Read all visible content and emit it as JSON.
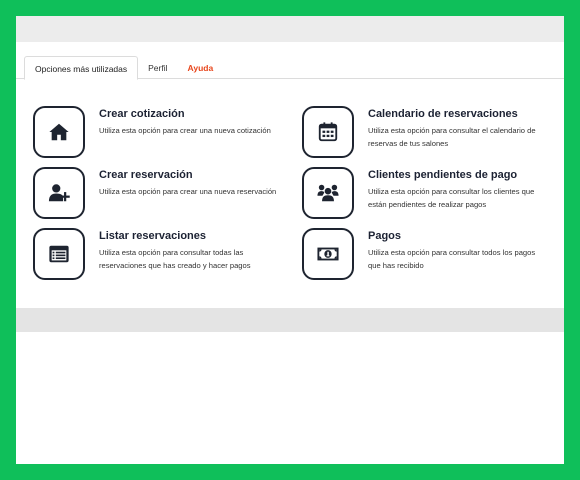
{
  "tabs": [
    {
      "label": "Opciones más utilizadas"
    },
    {
      "label": "Perfil"
    },
    {
      "label": "Ayuda"
    }
  ],
  "colors": {
    "background": "#0fbf5a",
    "accent": "#e8461c",
    "icon": "#1e2430"
  },
  "options": [
    {
      "title": "Crear cotización",
      "description": "Utiliza esta opción para crear una nueva cotización",
      "icon": "home-icon"
    },
    {
      "title": "Calendario de reservaciones",
      "description": "Utiliza esta opción para consultar el calendario de reservas de tus salones",
      "icon": "calendar-icon"
    },
    {
      "title": "Crear reservación",
      "description": "Utiliza esta opción para crear una nueva reservación",
      "icon": "add-user-icon"
    },
    {
      "title": "Clientes pendientes de pago",
      "description": "Utiliza esta opción para consultar los clientes que están pendientes de realizar pagos",
      "icon": "users-icon"
    },
    {
      "title": "Listar reservaciones",
      "description": "Utiliza esta opción para consultar todas las reservaciones que has creado y hacer pagos",
      "icon": "list-icon"
    },
    {
      "title": "Pagos",
      "description": "Utiliza esta opción para consultar todos los pagos que has recibido",
      "icon": "money-icon"
    }
  ]
}
